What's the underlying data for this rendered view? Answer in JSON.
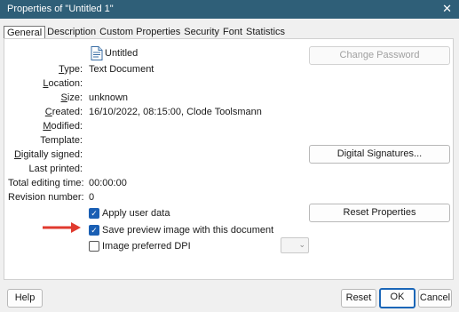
{
  "window": {
    "title": "Properties of \"Untitled 1\"",
    "close_glyph": "✕"
  },
  "tabs": [
    "General",
    "Description",
    "Custom Properties",
    "Security",
    "Font",
    "Statistics"
  ],
  "general": {
    "doc_name": "Untitled",
    "fields": [
      {
        "label_u": "T",
        "label_rest": "ype:",
        "value": "Text Document"
      },
      {
        "label_u": "L",
        "label_rest": "ocation:",
        "value": ""
      },
      {
        "label_u": "S",
        "label_rest": "ize:",
        "value": "unknown"
      },
      {
        "label_u": "C",
        "label_rest": "reated:",
        "value": "16/10/2022, 08:15:00, Clode Toolsmann"
      },
      {
        "label_u": "M",
        "label_rest": "odified:",
        "value": ""
      },
      {
        "label_u": "",
        "label_rest": "Template:",
        "value": ""
      },
      {
        "label_u": "D",
        "label_rest": "igitally signed:",
        "value": ""
      },
      {
        "label_u": "",
        "label_rest": "Last printed:",
        "value": ""
      },
      {
        "label_u": "",
        "label_rest": "Total editing time:",
        "value": "00:00:00"
      },
      {
        "label_u": "",
        "label_rest": "Revision number:",
        "value": "0"
      }
    ],
    "change_password": "Change Password",
    "digital_signatures": "Digital Signatures...",
    "reset_properties": "Reset Properties",
    "apply_user_data": {
      "label": "Apply user data",
      "checked": true
    },
    "save_preview": {
      "label": "Save preview image with this document",
      "checked": true
    },
    "image_dpi": {
      "label": "Image preferred DPI",
      "checked": false
    }
  },
  "footer": {
    "help": "Help",
    "reset": "Reset",
    "ok": "OK",
    "cancel": "Cancel"
  },
  "colors": {
    "titlebar": "#2f5f78",
    "checkbox": "#1a5fb4",
    "annotation_arrow": "#e03a2f"
  }
}
